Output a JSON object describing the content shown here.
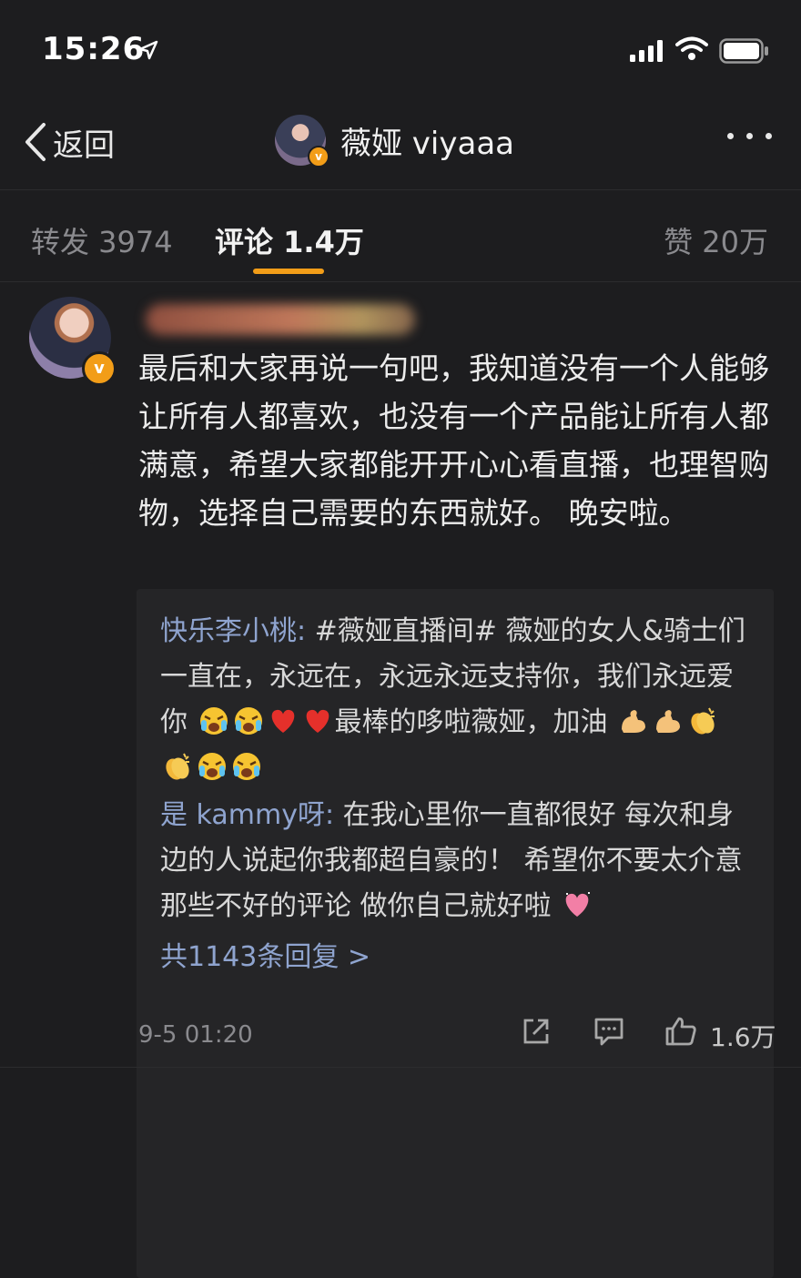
{
  "status_bar": {
    "time": "15:26"
  },
  "nav": {
    "back_label": "返回",
    "title": "薇娅 viyaaa",
    "badge": "v"
  },
  "tabs": [
    {
      "label": "转发 3974"
    },
    {
      "label": "评论 1.4万"
    },
    {
      "label": "赞 20万"
    }
  ],
  "comment": {
    "badge": "v",
    "text": "最后和大家再说一句吧，我知道没有一个人能够让所有人都喜欢，也没有一个产品能让所有人都满意，希望大家都能开开心心看直播，也理智购物，选择自己需要的东西就好。 晚安啦。",
    "replies": [
      {
        "name": "快乐李小桃:",
        "text_a": " #薇娅直播间# 薇娅的女人&骑士们一直在，永远在，永远永远支持你，我们永远爱你",
        "text_b": "最棒的哆啦薇娅，加油"
      },
      {
        "name": "是 kammy呀:",
        "text_a": " 在我心里你一直都很好 每次和身边的人说起你我都超自豪的！ 希望你不要太介意那些不好的评论 做你自己就好啦"
      }
    ],
    "total_replies": "共1143条回复 >",
    "date": "9-5 01:20",
    "likes": "1.6万"
  },
  "icons": {
    "accent": "#f29d18",
    "link_color": "#8fa4cf",
    "names": [
      "location-arrow-icon",
      "signal-icon",
      "wifi-icon",
      "battery-icon",
      "back-chevron-icon",
      "more-icon",
      "share-icon",
      "comment-icon",
      "like-icon"
    ]
  }
}
